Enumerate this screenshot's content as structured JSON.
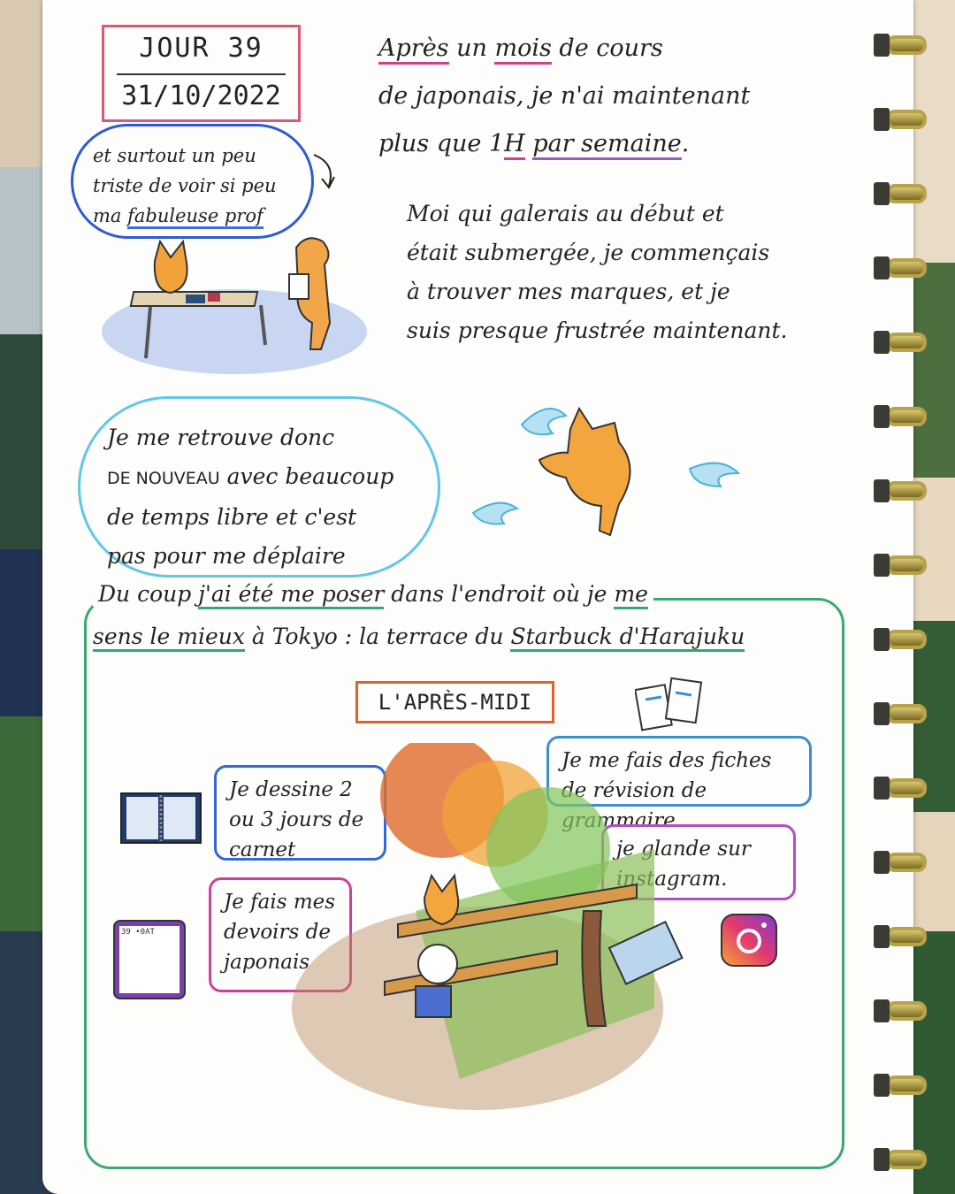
{
  "header": {
    "day": "JOUR 39",
    "date": "31/10/2022"
  },
  "intro": {
    "line1_a": "Après",
    "line1_b": " un ",
    "line1_c": "mois",
    "line1_d": " de cours",
    "line2": "de japonais, je n'ai maintenant",
    "line3_a": "plus que 1",
    "line3_b": "H",
    "line3_c": " ",
    "line3_d": "par semaine",
    "line3_e": "."
  },
  "bubble_prof": {
    "line1": "et surtout un peu",
    "line2": "triste de voir si peu",
    "line3_a": "ma ",
    "line3_b": "fabuleuse prof"
  },
  "paragraph2": {
    "line1": "Moi qui galerais au début et",
    "line2": "était submergée, je commençais",
    "line3": "à trouver mes marques, et je",
    "line4": "suis presque frustrée maintenant."
  },
  "cloud": {
    "line1": "Je me retrouve donc",
    "line2_caps": "DE NOUVEAU",
    "line2_rest": " avec beaucoup",
    "line3": "de temps libre et c'est",
    "line4": "pas pour me déplaire"
  },
  "green_section": {
    "l1_a": "Du coup ",
    "l1_b": "j'ai été me poser",
    "l1_c": " dans l'endroit où je ",
    "l1_d": "me",
    "l2_a": "sens le mieux",
    "l2_b": " à Tokyo : la terrace du ",
    "l2_c": "Starbuck d'Harajuku"
  },
  "afternoon_label": "L'APRÈS-MIDI",
  "activities": {
    "dessine": "Je dessine 2 ou 3 jours de carnet",
    "fiches": "Je me fais des fiches de révision de grammaire",
    "glande": "je glande sur instagram.",
    "devoirs": "Je fais mes devoirs de japonais"
  },
  "doodle_texts": {
    "tablet_header": "39 •0AT"
  },
  "icons": [
    "sketchbook-icon",
    "revision-cards-icon",
    "instagram-icon",
    "tablet-homework-icon"
  ],
  "colors": {
    "day_border": "#e0557a",
    "cloud_border": "#64c6e8",
    "green_frame": "#3aa971",
    "afternoon_border": "#e2602e"
  }
}
